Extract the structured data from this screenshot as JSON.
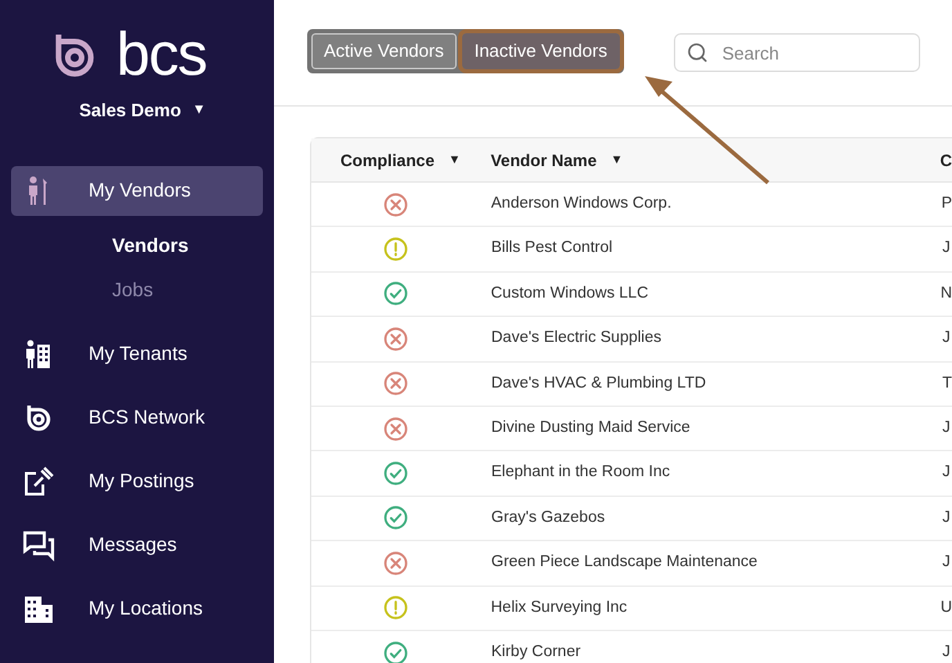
{
  "sidebar": {
    "logo_text": "bcs",
    "account": "Sales Demo",
    "account_caret": "▼",
    "items": [
      {
        "label": "My Vendors",
        "kind": "vendor",
        "selected": true,
        "children": [
          {
            "label": "Vendors",
            "selected": true
          },
          {
            "label": "Jobs",
            "selected": false
          }
        ]
      },
      {
        "label": "My Tenants",
        "kind": "tenants",
        "selected": false
      },
      {
        "label": "BCS Network",
        "kind": "network",
        "selected": false
      },
      {
        "label": "My Postings",
        "kind": "postings",
        "selected": false
      },
      {
        "label": "Messages",
        "kind": "messages",
        "selected": false
      },
      {
        "label": "My Locations",
        "kind": "locations",
        "selected": false
      }
    ]
  },
  "tabs": [
    {
      "label": "Active Vendors",
      "selected": true
    },
    {
      "label": "Inactive Vendors",
      "selected": false,
      "highlighted": true
    }
  ],
  "search": {
    "placeholder": "Search"
  },
  "table": {
    "columns": [
      {
        "label": "Compliance",
        "sort": "▼"
      },
      {
        "label": "Vendor Name",
        "sort": "▼"
      },
      {
        "label": "C"
      }
    ],
    "rows": [
      {
        "kind": "fail",
        "name": "Anderson Windows Corp.",
        "column_3": "P"
      },
      {
        "kind": "warn",
        "name": "Bills Pest Control",
        "column_3": "J"
      },
      {
        "kind": "pass",
        "name": "Custom Windows LLC",
        "column_3": "N"
      },
      {
        "kind": "fail",
        "name": "Dave's Electric Supplies",
        "column_3": "J"
      },
      {
        "kind": "fail",
        "name": "Dave's HVAC & Plumbing LTD",
        "column_3": "T"
      },
      {
        "kind": "fail",
        "name": "Divine Dusting Maid Service",
        "column_3": "J"
      },
      {
        "kind": "pass",
        "name": "Elephant in the Room Inc",
        "column_3": "J"
      },
      {
        "kind": "pass",
        "name": "Gray's Gazebos",
        "column_3": "J"
      },
      {
        "kind": "fail",
        "name": "Green Piece Landscape Maintenance",
        "column_3": "J"
      },
      {
        "kind": "warn",
        "name": "Helix Surveying Inc",
        "column_3": "U"
      },
      {
        "kind": "pass",
        "name": "Kirby Corner",
        "column_3": "J"
      }
    ]
  }
}
